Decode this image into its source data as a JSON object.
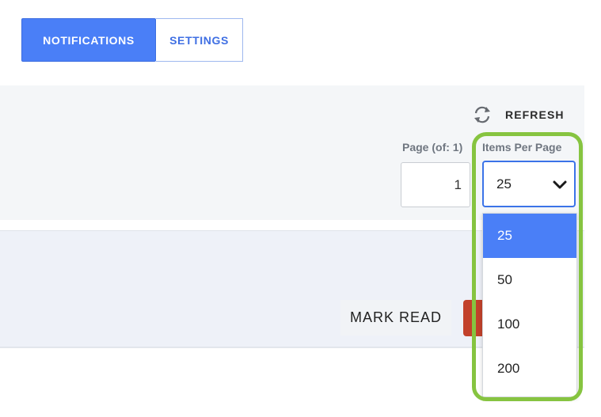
{
  "tabs": [
    {
      "label": "NOTIFICATIONS",
      "active": true
    },
    {
      "label": "SETTINGS",
      "active": false
    }
  ],
  "toolbar": {
    "refresh_label": "REFRESH",
    "refresh_icon": "refresh-icon",
    "page_label": "Page (of: 1)",
    "page_value": "1",
    "items_per_page_label": "Items Per Page",
    "items_per_page_value": "25",
    "items_per_page_options": [
      "25",
      "50",
      "100",
      "200"
    ],
    "dropdown_icon": "chevron-down-icon"
  },
  "actions": {
    "mark_read_label": "MARK READ"
  },
  "colors": {
    "accent": "#4a7ff7",
    "danger": "#c2412b",
    "highlight": "#86c440"
  }
}
